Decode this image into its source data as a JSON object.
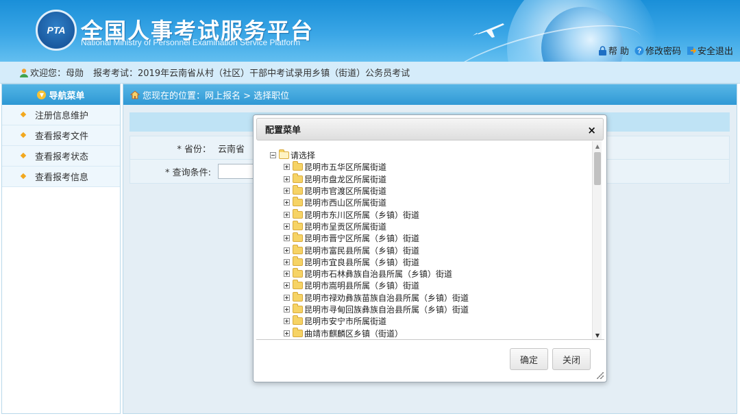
{
  "header": {
    "logo_text": "PTA",
    "title": "全国人事考试服务平台",
    "subtitle": "National Ministry of Personnel Examination Service Platform",
    "links": [
      {
        "label": "帮 助",
        "icon": "lock-icon",
        "color": "#1e6fc4"
      },
      {
        "label": "修改密码",
        "icon": "help-icon",
        "color": "#2b8fe0"
      },
      {
        "label": "安全退出",
        "icon": "exit-icon",
        "color": "#2b8fe0"
      }
    ]
  },
  "infobar": {
    "welcome": "欢迎您：母勋",
    "exam": "报考考试：2019年云南省从村（社区）干部中考试录用乡镇（街道）公务员考试"
  },
  "sidebar": {
    "title": "导航菜单",
    "items": [
      {
        "label": "注册信息维护"
      },
      {
        "label": "查看报考文件"
      },
      {
        "label": "查看报考状态"
      },
      {
        "label": "查看报考信息"
      }
    ]
  },
  "breadcrumb": {
    "text": "您现在的位置：网上报名 > 选择职位"
  },
  "form": {
    "province_label": "* 省份：",
    "province_value": "云南省",
    "query_label": "* 查询条件:"
  },
  "dialog": {
    "title": "配置菜单",
    "close": "×",
    "root": "请选择",
    "items": [
      "昆明市五华区所属街道",
      "昆明市盘龙区所属街道",
      "昆明市官渡区所属街道",
      "昆明市西山区所属街道",
      "昆明市东川区所属（乡镇）街道",
      "昆明市呈贡区所属街道",
      "昆明市晋宁区所属（乡镇）街道",
      "昆明市富民县所属（乡镇）街道",
      "昆明市宜良县所属（乡镇）街道",
      "昆明市石林彝族自治县所属（乡镇）街道",
      "昆明市嵩明县所属（乡镇）街道",
      "昆明市禄劝彝族苗族自治县所属（乡镇）街道",
      "昆明市寻甸回族彝族自治县所属（乡镇）街道",
      "昆明市安宁市所属街道",
      "曲靖市麒麟区乡镇（街道）"
    ],
    "ok": "确定",
    "cancel": "关闭"
  }
}
